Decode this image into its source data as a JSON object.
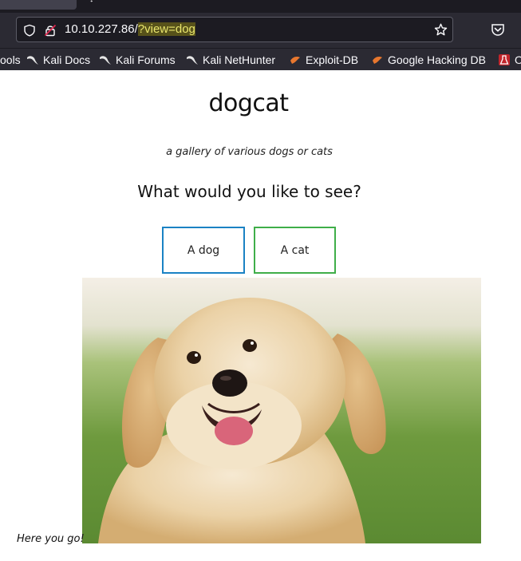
{
  "browser": {
    "url_host": "10.10.227.86/",
    "url_path": "?view=dog"
  },
  "bookmarks": [
    {
      "label": "ools",
      "icon": "none"
    },
    {
      "label": "Kali Docs",
      "icon": "kali-dragon-icon"
    },
    {
      "label": "Kali Forums",
      "icon": "kali-dragon-icon"
    },
    {
      "label": "Kali NetHunter",
      "icon": "kali-dragon-icon"
    },
    {
      "label": "Exploit-DB",
      "icon": "exploit-db-icon"
    },
    {
      "label": "Google Hacking DB",
      "icon": "exploit-db-icon"
    },
    {
      "label": "O",
      "icon": "offsec-icon"
    }
  ],
  "page": {
    "title": "dogcat",
    "subtitle": "a gallery of various dogs or cats",
    "question": "What would you like to see?",
    "dog_button": "A dog",
    "cat_button": "A cat",
    "image_subject": "golden retriever photo",
    "footer_text": "Here you go!"
  },
  "colors": {
    "dog_button_border": "#1a82c4",
    "cat_button_border": "#3fae49",
    "url_highlight": "#57521a"
  }
}
